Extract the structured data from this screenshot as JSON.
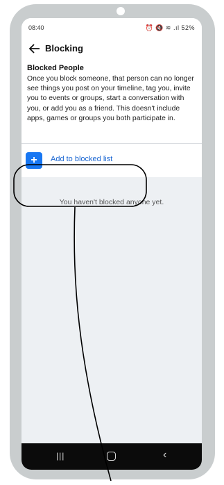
{
  "status_bar": {
    "time": "08:40",
    "icons_text": "⏰ 🔇 ≋ 𝄩 .ıl 52%",
    "battery": "52%"
  },
  "header": {
    "title": "Blocking",
    "back_icon": "arrow-left-icon"
  },
  "info": {
    "title": "Blocked People",
    "description": "Once you block someone, that person can no longer see things you post on your timeline, tag you, invite you to events or groups, start a conversation with you, or add you as a friend. This doesn't include apps, games or groups you both participate in."
  },
  "add_blocked": {
    "icon": "plus-icon",
    "icon_glyph": "+",
    "label": "Add to blocked list"
  },
  "empty_state": {
    "text": "You haven't blocked anyone yet."
  },
  "nav_bar": {
    "recent_glyph": "|||",
    "home_icon": "home-icon",
    "back_glyph": "‹"
  },
  "colors": {
    "accent": "#1877f2",
    "link": "#1a66d2",
    "screen_bg": "#edf0f3",
    "frame": "#c9cdce"
  }
}
